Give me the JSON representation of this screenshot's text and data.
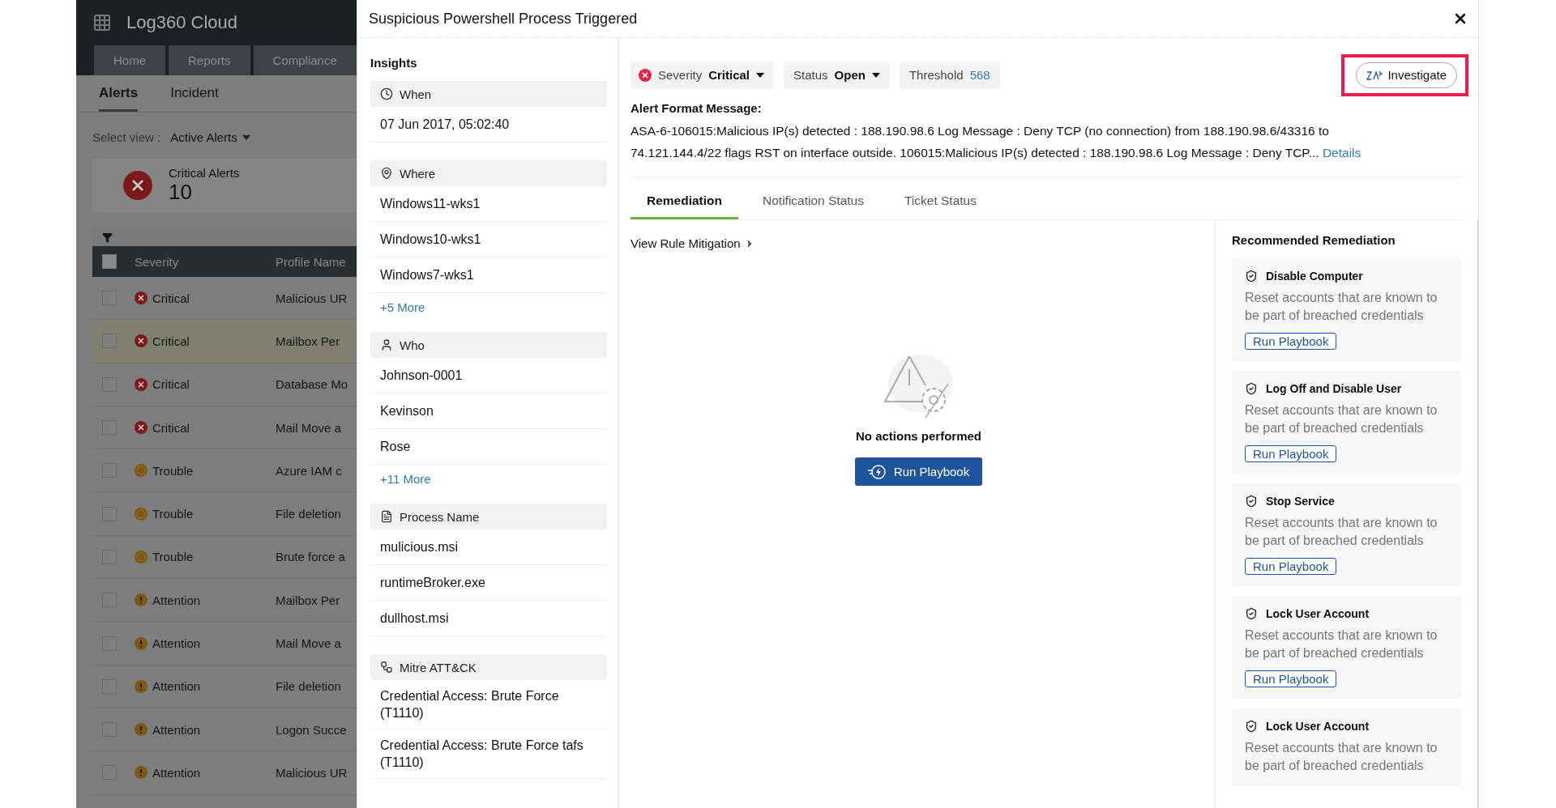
{
  "background_app": {
    "logo": "Log360 Cloud",
    "nav_tabs": [
      "Home",
      "Reports",
      "Compliance"
    ],
    "subtabs": [
      {
        "label": "Alerts",
        "selected": true
      },
      {
        "label": "Incident",
        "selected": false
      }
    ],
    "view_label": "Select view :",
    "view_value": "Active Alerts",
    "summary": {
      "label": "Critical Alerts",
      "count": "10"
    },
    "table": {
      "columns": [
        "Severity",
        "Profile Name"
      ],
      "select_all_checked": false,
      "rows": [
        {
          "severity": "Critical",
          "kind": "critical",
          "profile": "Malicious UR",
          "selected": false,
          "checked": false
        },
        {
          "severity": "Critical",
          "kind": "critical",
          "profile": "Mailbox Per",
          "selected": true,
          "checked": false
        },
        {
          "severity": "Critical",
          "kind": "critical",
          "profile": "Database Mo",
          "selected": false,
          "checked": false
        },
        {
          "severity": "Critical",
          "kind": "critical",
          "profile": "Mail Move a",
          "selected": false,
          "checked": false
        },
        {
          "severity": "Trouble",
          "kind": "trouble",
          "profile": "Azure IAM c",
          "selected": false,
          "checked": false
        },
        {
          "severity": "Trouble",
          "kind": "trouble",
          "profile": "File deletion",
          "selected": false,
          "checked": false
        },
        {
          "severity": "Trouble",
          "kind": "trouble",
          "profile": "Brute force a",
          "selected": false,
          "checked": false
        },
        {
          "severity": "Attention",
          "kind": "attention",
          "profile": "Mailbox Per",
          "selected": false,
          "checked": false
        },
        {
          "severity": "Attention",
          "kind": "attention",
          "profile": "Mail Move a",
          "selected": false,
          "checked": false
        },
        {
          "severity": "Attention",
          "kind": "attention",
          "profile": "File deletion",
          "selected": false,
          "checked": false
        },
        {
          "severity": "Attention",
          "kind": "attention",
          "profile": "Logon Succe",
          "selected": false,
          "checked": false
        },
        {
          "severity": "Attention",
          "kind": "attention",
          "profile": "Malicious UR",
          "selected": false,
          "checked": false
        }
      ]
    }
  },
  "modal": {
    "title": "Suspicious Powershell Process Triggered",
    "insights": {
      "title": "Insights",
      "sections": [
        {
          "title": "When",
          "kind": "clock",
          "items": [
            "07 Jun 2017, 05:02:40"
          ]
        },
        {
          "title": "Where",
          "kind": "pin",
          "items": [
            "Windows11-wks1",
            "Windows10-wks1",
            "Windows7-wks1"
          ],
          "more": "+5 More"
        },
        {
          "title": "Who",
          "kind": "user",
          "items": [
            "Johnson-0001",
            "Kevinson",
            "Rose"
          ],
          "more": "+11 More"
        },
        {
          "title": "Process Name",
          "kind": "file",
          "items": [
            "mulicious.msi",
            "runtimeBroker.exe",
            "dullhost.msi"
          ]
        },
        {
          "title": "Mitre ATT&CK",
          "kind": "network",
          "items": [
            "Credential Access: Brute Force (T1110)",
            "Credential Access: Brute Force tafs (T1110)"
          ]
        }
      ]
    },
    "chips": [
      {
        "kind": "severity",
        "label": "Severity",
        "value": "Critical"
      },
      {
        "kind": "status",
        "label": "Status",
        "value": "Open"
      },
      {
        "kind": "threshold",
        "label": "Threshold",
        "value": "568"
      }
    ],
    "investigate": {
      "label": "Investigate",
      "highlighted": true
    },
    "alert_message": {
      "title": "Alert Format Message:",
      "text": "ASA-6-106015:Malicious IP(s) detected : 188.190.98.6 Log Message : Deny TCP (no connection) from 188.190.98.6/43316 to 74.121.144.4/22 flags RST on interface outside. 106015:Malicious IP(s) detected : 188.190.98.6 Log Message : Deny TCP...",
      "link": "Details"
    },
    "tabs": [
      {
        "label": "Remediation",
        "selected": true
      },
      {
        "label": "Notification Status",
        "selected": false
      },
      {
        "label": "Ticket Status",
        "selected": false
      }
    ],
    "rule_link": "View Rule Mitigation",
    "empty_state": {
      "message": "No actions performed",
      "button": "Run Playbook"
    },
    "recommended": {
      "title": "Recommended Remediation",
      "cards": [
        {
          "title": "Disable Computer",
          "description": "Reset accounts that are known to be part of breached credentials",
          "button": "Run Playbook"
        },
        {
          "title": "Log Off and Disable User",
          "description": "Reset accounts that are known to be part of breached credentials",
          "button": "Run Playbook"
        },
        {
          "title": "Stop Service",
          "description": "Reset accounts that are known to be part of breached credentials",
          "button": "Run Playbook"
        },
        {
          "title": "Lock User Account",
          "description": "Reset accounts that are known to be part of breached credentials",
          "button": "Run Playbook"
        },
        {
          "title": "Lock User Account",
          "description": "Reset accounts that are known to be part of breached credentials"
        }
      ]
    }
  }
}
